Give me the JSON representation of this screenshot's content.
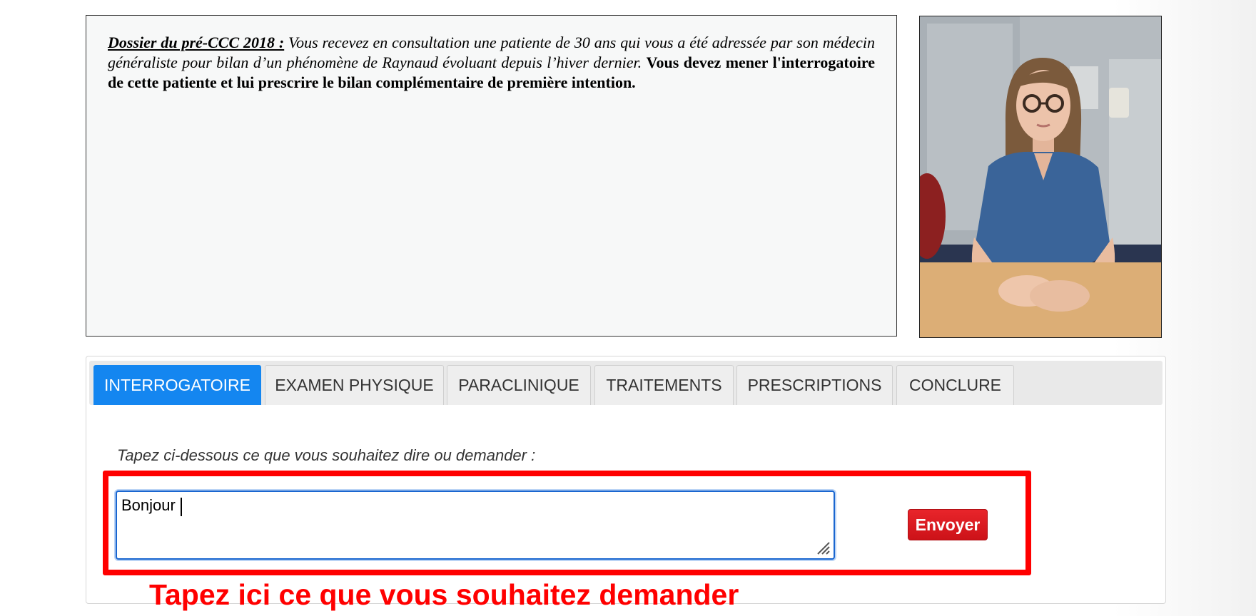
{
  "case": {
    "title": "Dossier du pré-CCC 2018 :",
    "intro": "Vous recevez en consultation une patiente de 30 ans qui vous a été adressée par son médecin généraliste pour bilan d’un phénomène de Raynaud évoluant depuis l’hiver dernier.",
    "instruction": "Vous devez mener l'interrogatoire de cette patiente et lui prescrire le bilan complémentaire de première intention."
  },
  "tabs": [
    {
      "label": "INTERROGATOIRE",
      "active": true
    },
    {
      "label": "EXAMEN PHYSIQUE",
      "active": false
    },
    {
      "label": "PARACLINIQUE",
      "active": false
    },
    {
      "label": "TRAITEMENTS",
      "active": false
    },
    {
      "label": "PRESCRIPTIONS",
      "active": false
    },
    {
      "label": "CONCLURE",
      "active": false
    }
  ],
  "chat": {
    "prompt": "Tapez ci-dessous ce que vous souhaitez dire ou demander :",
    "input_value": "Bonjour",
    "send_label": "Envoyer"
  },
  "annotation": {
    "hint": "Tapez ici ce que vous souhaitez demander"
  },
  "colors": {
    "active_tab": "#1486f0",
    "send_button": "#dd1a20",
    "highlight": "#ff0000"
  }
}
